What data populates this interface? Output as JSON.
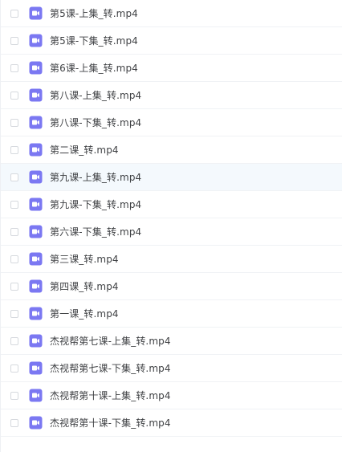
{
  "file_list": {
    "icon_type": "video-file-icon",
    "icon_color": "#7b78f2",
    "hover_background": "#f4f9fd",
    "items": [
      {
        "name": "第5课-上集_转.mp4"
      },
      {
        "name": "第5课-下集_转.mp4"
      },
      {
        "name": "第6课-上集_转.mp4"
      },
      {
        "name": "第八课-上集_转.mp4"
      },
      {
        "name": "第八课-下集_转.mp4"
      },
      {
        "name": "第二课_转.mp4"
      },
      {
        "name": "第九课-上集_转.mp4"
      },
      {
        "name": "第九课-下集_转.mp4"
      },
      {
        "name": "第六课-下集_转.mp4"
      },
      {
        "name": "第三课_转.mp4"
      },
      {
        "name": "第四课_转.mp4"
      },
      {
        "name": "第一课_转.mp4"
      },
      {
        "name": "杰视帮第七课-上集_转.mp4"
      },
      {
        "name": "杰视帮第七课-下集_转.mp4"
      },
      {
        "name": "杰视帮第十课-上集_转.mp4"
      },
      {
        "name": "杰视帮第十课-下集_转.mp4"
      }
    ]
  }
}
